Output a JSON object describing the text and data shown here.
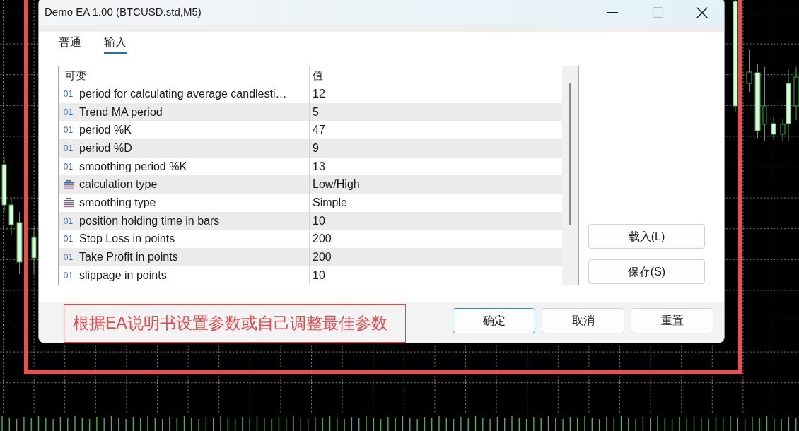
{
  "dialog": {
    "title": "Demo EA 1.00 (BTCUSD.std,M5)",
    "window_buttons": [
      {
        "kind": "minimize",
        "disabled": false
      },
      {
        "kind": "maximize",
        "disabled": true
      },
      {
        "kind": "close",
        "disabled": false
      }
    ],
    "tabs": [
      {
        "label": "普通",
        "selected": false
      },
      {
        "label": "输入",
        "selected": true
      }
    ],
    "table": {
      "columns": [
        "可变",
        "值"
      ],
      "rows": [
        {
          "kind": "integer",
          "type_code": "01",
          "name": "period for calculating average candlesti…",
          "value": "12"
        },
        {
          "kind": "integer",
          "type_code": "01",
          "name": "Trend MA period",
          "value": "5"
        },
        {
          "kind": "integer",
          "type_code": "01",
          "name": "period %K",
          "value": "47"
        },
        {
          "kind": "integer",
          "type_code": "01",
          "name": "period %D",
          "value": "9"
        },
        {
          "kind": "integer",
          "type_code": "01",
          "name": "smoothing period %K",
          "value": "13"
        },
        {
          "kind": "enum",
          "name": "calculation type",
          "value": "Low/High"
        },
        {
          "kind": "enum",
          "name": "smoothing type",
          "value": "Simple"
        },
        {
          "kind": "integer",
          "type_code": "01",
          "name": "position holding time in bars",
          "value": "10"
        },
        {
          "kind": "integer",
          "type_code": "01",
          "name": "Stop Loss in points",
          "value": "200"
        },
        {
          "kind": "integer",
          "type_code": "01",
          "name": "Take Profit in points",
          "value": "200"
        },
        {
          "kind": "integer",
          "type_code": "01",
          "name": "slippage in points",
          "value": "10"
        }
      ]
    },
    "side_buttons": [
      "载入(L)",
      "保存(S)"
    ],
    "buttons": [
      {
        "label": "确定",
        "default": true
      },
      {
        "label": "取消",
        "default": false
      },
      {
        "label": "重置",
        "default": false
      }
    ]
  },
  "annotation": {
    "text": "根据EA说明书设置参数或自己调整最佳参数"
  }
}
